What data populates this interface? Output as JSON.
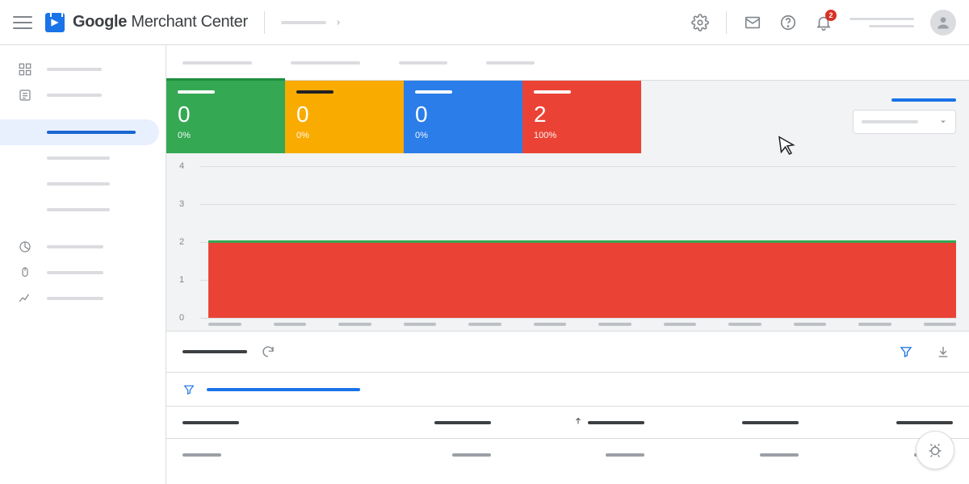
{
  "brand": {
    "google": "Google",
    "product": "Merchant Center"
  },
  "notifications": {
    "count": "2"
  },
  "cards": [
    {
      "value": "0",
      "percent": "0%",
      "color": "green",
      "active": true
    },
    {
      "value": "0",
      "percent": "0%",
      "color": "yellow",
      "active": false
    },
    {
      "value": "0",
      "percent": "0%",
      "color": "blue",
      "active": false
    },
    {
      "value": "2",
      "percent": "100%",
      "color": "red",
      "active": false
    }
  ],
  "chart_data": {
    "type": "area",
    "y_ticks": [
      "0",
      "1",
      "2",
      "3",
      "4"
    ],
    "ylim": [
      0,
      4
    ],
    "series": [
      {
        "name": "red-series",
        "constant_value": 2,
        "fill": true,
        "color": "#ea4335"
      },
      {
        "name": "green-series",
        "constant_value": 2,
        "fill": false,
        "color": "#34a853"
      }
    ],
    "x_tick_count": 12
  },
  "table": {
    "columns": 5,
    "sort_col_index": 2,
    "sort_dir": "asc"
  }
}
